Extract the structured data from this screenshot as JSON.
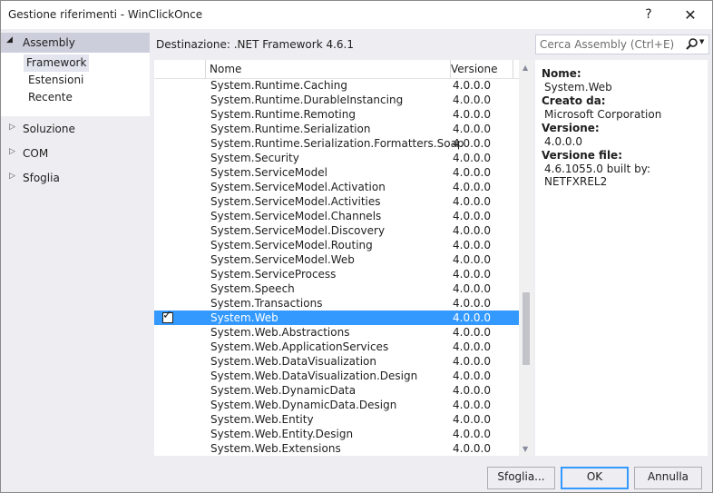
{
  "window": {
    "title": "Gestione riferimenti - WinClickOnce",
    "help_glyph": "?",
    "close_glyph": "✕"
  },
  "left": {
    "assembly": {
      "label": "Assembly",
      "items": [
        "Framework",
        "Estensioni",
        "Recente"
      ],
      "selected": "Framework"
    },
    "categories": [
      "Soluzione",
      "COM",
      "Sfoglia"
    ]
  },
  "destination": "Destinazione: .NET Framework 4.6.1",
  "grid": {
    "headers": {
      "name": "Nome",
      "version": "Versione"
    },
    "rows": [
      {
        "name": "System.Runtime.Caching",
        "version": "4.0.0.0"
      },
      {
        "name": "System.Runtime.DurableInstancing",
        "version": "4.0.0.0"
      },
      {
        "name": "System.Runtime.Remoting",
        "version": "4.0.0.0"
      },
      {
        "name": "System.Runtime.Serialization",
        "version": "4.0.0.0"
      },
      {
        "name": "System.Runtime.Serialization.Formatters.Soap",
        "version": "4.0.0.0"
      },
      {
        "name": "System.Security",
        "version": "4.0.0.0"
      },
      {
        "name": "System.ServiceModel",
        "version": "4.0.0.0"
      },
      {
        "name": "System.ServiceModel.Activation",
        "version": "4.0.0.0"
      },
      {
        "name": "System.ServiceModel.Activities",
        "version": "4.0.0.0"
      },
      {
        "name": "System.ServiceModel.Channels",
        "version": "4.0.0.0"
      },
      {
        "name": "System.ServiceModel.Discovery",
        "version": "4.0.0.0"
      },
      {
        "name": "System.ServiceModel.Routing",
        "version": "4.0.0.0"
      },
      {
        "name": "System.ServiceModel.Web",
        "version": "4.0.0.0"
      },
      {
        "name": "System.ServiceProcess",
        "version": "4.0.0.0"
      },
      {
        "name": "System.Speech",
        "version": "4.0.0.0"
      },
      {
        "name": "System.Transactions",
        "version": "4.0.0.0"
      },
      {
        "name": "System.Web",
        "version": "4.0.0.0",
        "checked": true,
        "selected": true
      },
      {
        "name": "System.Web.Abstractions",
        "version": "4.0.0.0"
      },
      {
        "name": "System.Web.ApplicationServices",
        "version": "4.0.0.0"
      },
      {
        "name": "System.Web.DataVisualization",
        "version": "4.0.0.0"
      },
      {
        "name": "System.Web.DataVisualization.Design",
        "version": "4.0.0.0"
      },
      {
        "name": "System.Web.DynamicData",
        "version": "4.0.0.0"
      },
      {
        "name": "System.Web.DynamicData.Design",
        "version": "4.0.0.0"
      },
      {
        "name": "System.Web.Entity",
        "version": "4.0.0.0"
      },
      {
        "name": "System.Web.Entity.Design",
        "version": "4.0.0.0"
      },
      {
        "name": "System.Web.Extensions",
        "version": "4.0.0.0"
      }
    ]
  },
  "search": {
    "placeholder": "Cerca Assembly (Ctrl+E)",
    "icon": "search-icon"
  },
  "details": {
    "name_label": "Nome:",
    "name_value": "System.Web",
    "created_label": "Creato da:",
    "created_value": "Microsoft Corporation",
    "version_label": "Versione:",
    "version_value": "4.0.0.0",
    "file_version_label": "Versione file:",
    "file_version_value": "4.6.1055.0 built by: NETFXREL2"
  },
  "buttons": {
    "browse": "Sfoglia...",
    "ok": "OK",
    "cancel": "Annulla"
  },
  "colors": {
    "selection": "#3399ff",
    "header_selected": "#cccedb",
    "window_bg": "#eeeef2"
  }
}
